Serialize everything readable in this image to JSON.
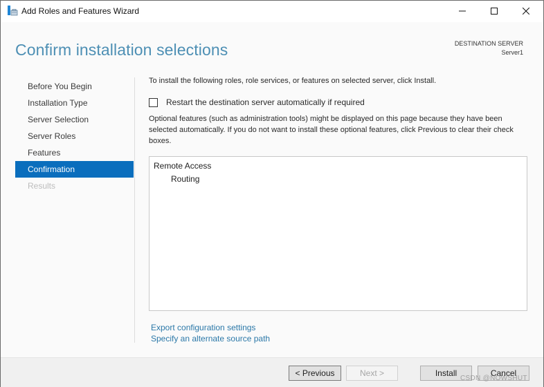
{
  "window": {
    "title": "Add Roles and Features Wizard",
    "app_icon": "server-manager-wizard-icon",
    "controls": {
      "minimize_icon": "minimize-icon",
      "maximize_icon": "maximize-icon",
      "close_icon": "close-icon"
    }
  },
  "header": {
    "page_title": "Confirm installation selections",
    "destination_label": "DESTINATION SERVER",
    "destination_value": "Server1"
  },
  "colors": {
    "accent": "#0a6ebd",
    "title": "#4d8fb4",
    "link": "#2b78a8",
    "disabled_text": "#bcbcbc"
  },
  "nav": {
    "items": [
      {
        "label": "Before You Begin",
        "state": "normal"
      },
      {
        "label": "Installation Type",
        "state": "normal"
      },
      {
        "label": "Server Selection",
        "state": "normal"
      },
      {
        "label": "Server Roles",
        "state": "normal"
      },
      {
        "label": "Features",
        "state": "normal"
      },
      {
        "label": "Confirmation",
        "state": "active"
      },
      {
        "label": "Results",
        "state": "disabled"
      }
    ]
  },
  "content": {
    "intro": "To install the following roles, role services, or features on selected server, click Install.",
    "restart_checkbox": {
      "label": "Restart the destination server automatically if required",
      "checked": false
    },
    "optional_text": "Optional features (such as administration tools) might be displayed on this page because they have been selected automatically. If you do not want to install these optional features, click Previous to clear their check boxes.",
    "selections": [
      {
        "label": "Remote Access",
        "level": 0
      },
      {
        "label": "Routing",
        "level": 1
      }
    ],
    "links": {
      "export": "Export configuration settings",
      "alternate_source": "Specify an alternate source path"
    }
  },
  "footer": {
    "previous_label": "< Previous",
    "next_label": "Next >",
    "install_label": "Install",
    "cancel_label": "Cancel"
  },
  "watermark": "CSDN @NOWSHUT"
}
